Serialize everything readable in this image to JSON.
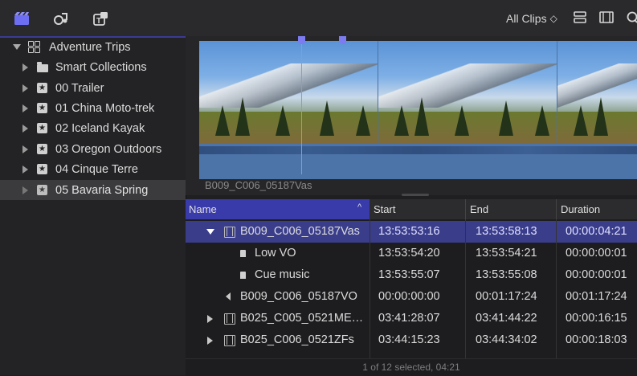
{
  "toolbar": {
    "icons": [
      "libraries-icon",
      "photos-audio-icon",
      "titles-generators-icon"
    ],
    "filter_label": "All Clips",
    "view_icons": [
      "list-view-icon",
      "filmstrip-view-icon",
      "search-icon"
    ]
  },
  "sidebar": {
    "library": "Adventure Trips",
    "items": [
      {
        "label": "Smart Collections",
        "icon": "folder-icon"
      },
      {
        "label": "00 Trailer",
        "icon": "event-star-icon"
      },
      {
        "label": "01 China Moto-trek",
        "icon": "event-star-icon"
      },
      {
        "label": "02 Iceland Kayak",
        "icon": "event-star-icon"
      },
      {
        "label": "03 Oregon Outdoors",
        "icon": "event-star-icon"
      },
      {
        "label": "04 Cinque Terre",
        "icon": "event-star-icon"
      },
      {
        "label": "05 Bavaria Spring",
        "icon": "event-star-icon",
        "selected": true
      }
    ]
  },
  "filmstrip": {
    "clip_name": "B009_C006_05187Vas"
  },
  "list": {
    "columns": {
      "name": "Name",
      "start": "Start",
      "end": "End",
      "duration": "Duration"
    },
    "rows": [
      {
        "name": "B009_C006_05187Vas",
        "start": "13:53:53:16",
        "end": "13:53:58:13",
        "duration": "00:00:04:21",
        "type": "clip",
        "expanded": true,
        "selected": true
      },
      {
        "name": "Low VO",
        "start": "13:53:54:20",
        "end": "13:53:54:21",
        "duration": "00:00:00:01",
        "type": "marker"
      },
      {
        "name": "Cue music",
        "start": "13:53:55:07",
        "end": "13:53:55:08",
        "duration": "00:00:00:01",
        "type": "marker"
      },
      {
        "name": "B009_C006_05187VO",
        "start": "00:00:00:00",
        "end": "00:01:17:24",
        "duration": "00:01:17:24",
        "type": "audio"
      },
      {
        "name": "B025_C005_0521ME…",
        "start": "03:41:28:07",
        "end": "03:41:44:22",
        "duration": "00:00:16:15",
        "type": "clip",
        "expanded": false
      },
      {
        "name": "B025_C006_0521ZFs",
        "start": "03:44:15:23",
        "end": "03:44:34:02",
        "duration": "00:00:18:03",
        "type": "clip",
        "expanded": false
      }
    ]
  },
  "status": "1 of 12 selected, 04:21"
}
